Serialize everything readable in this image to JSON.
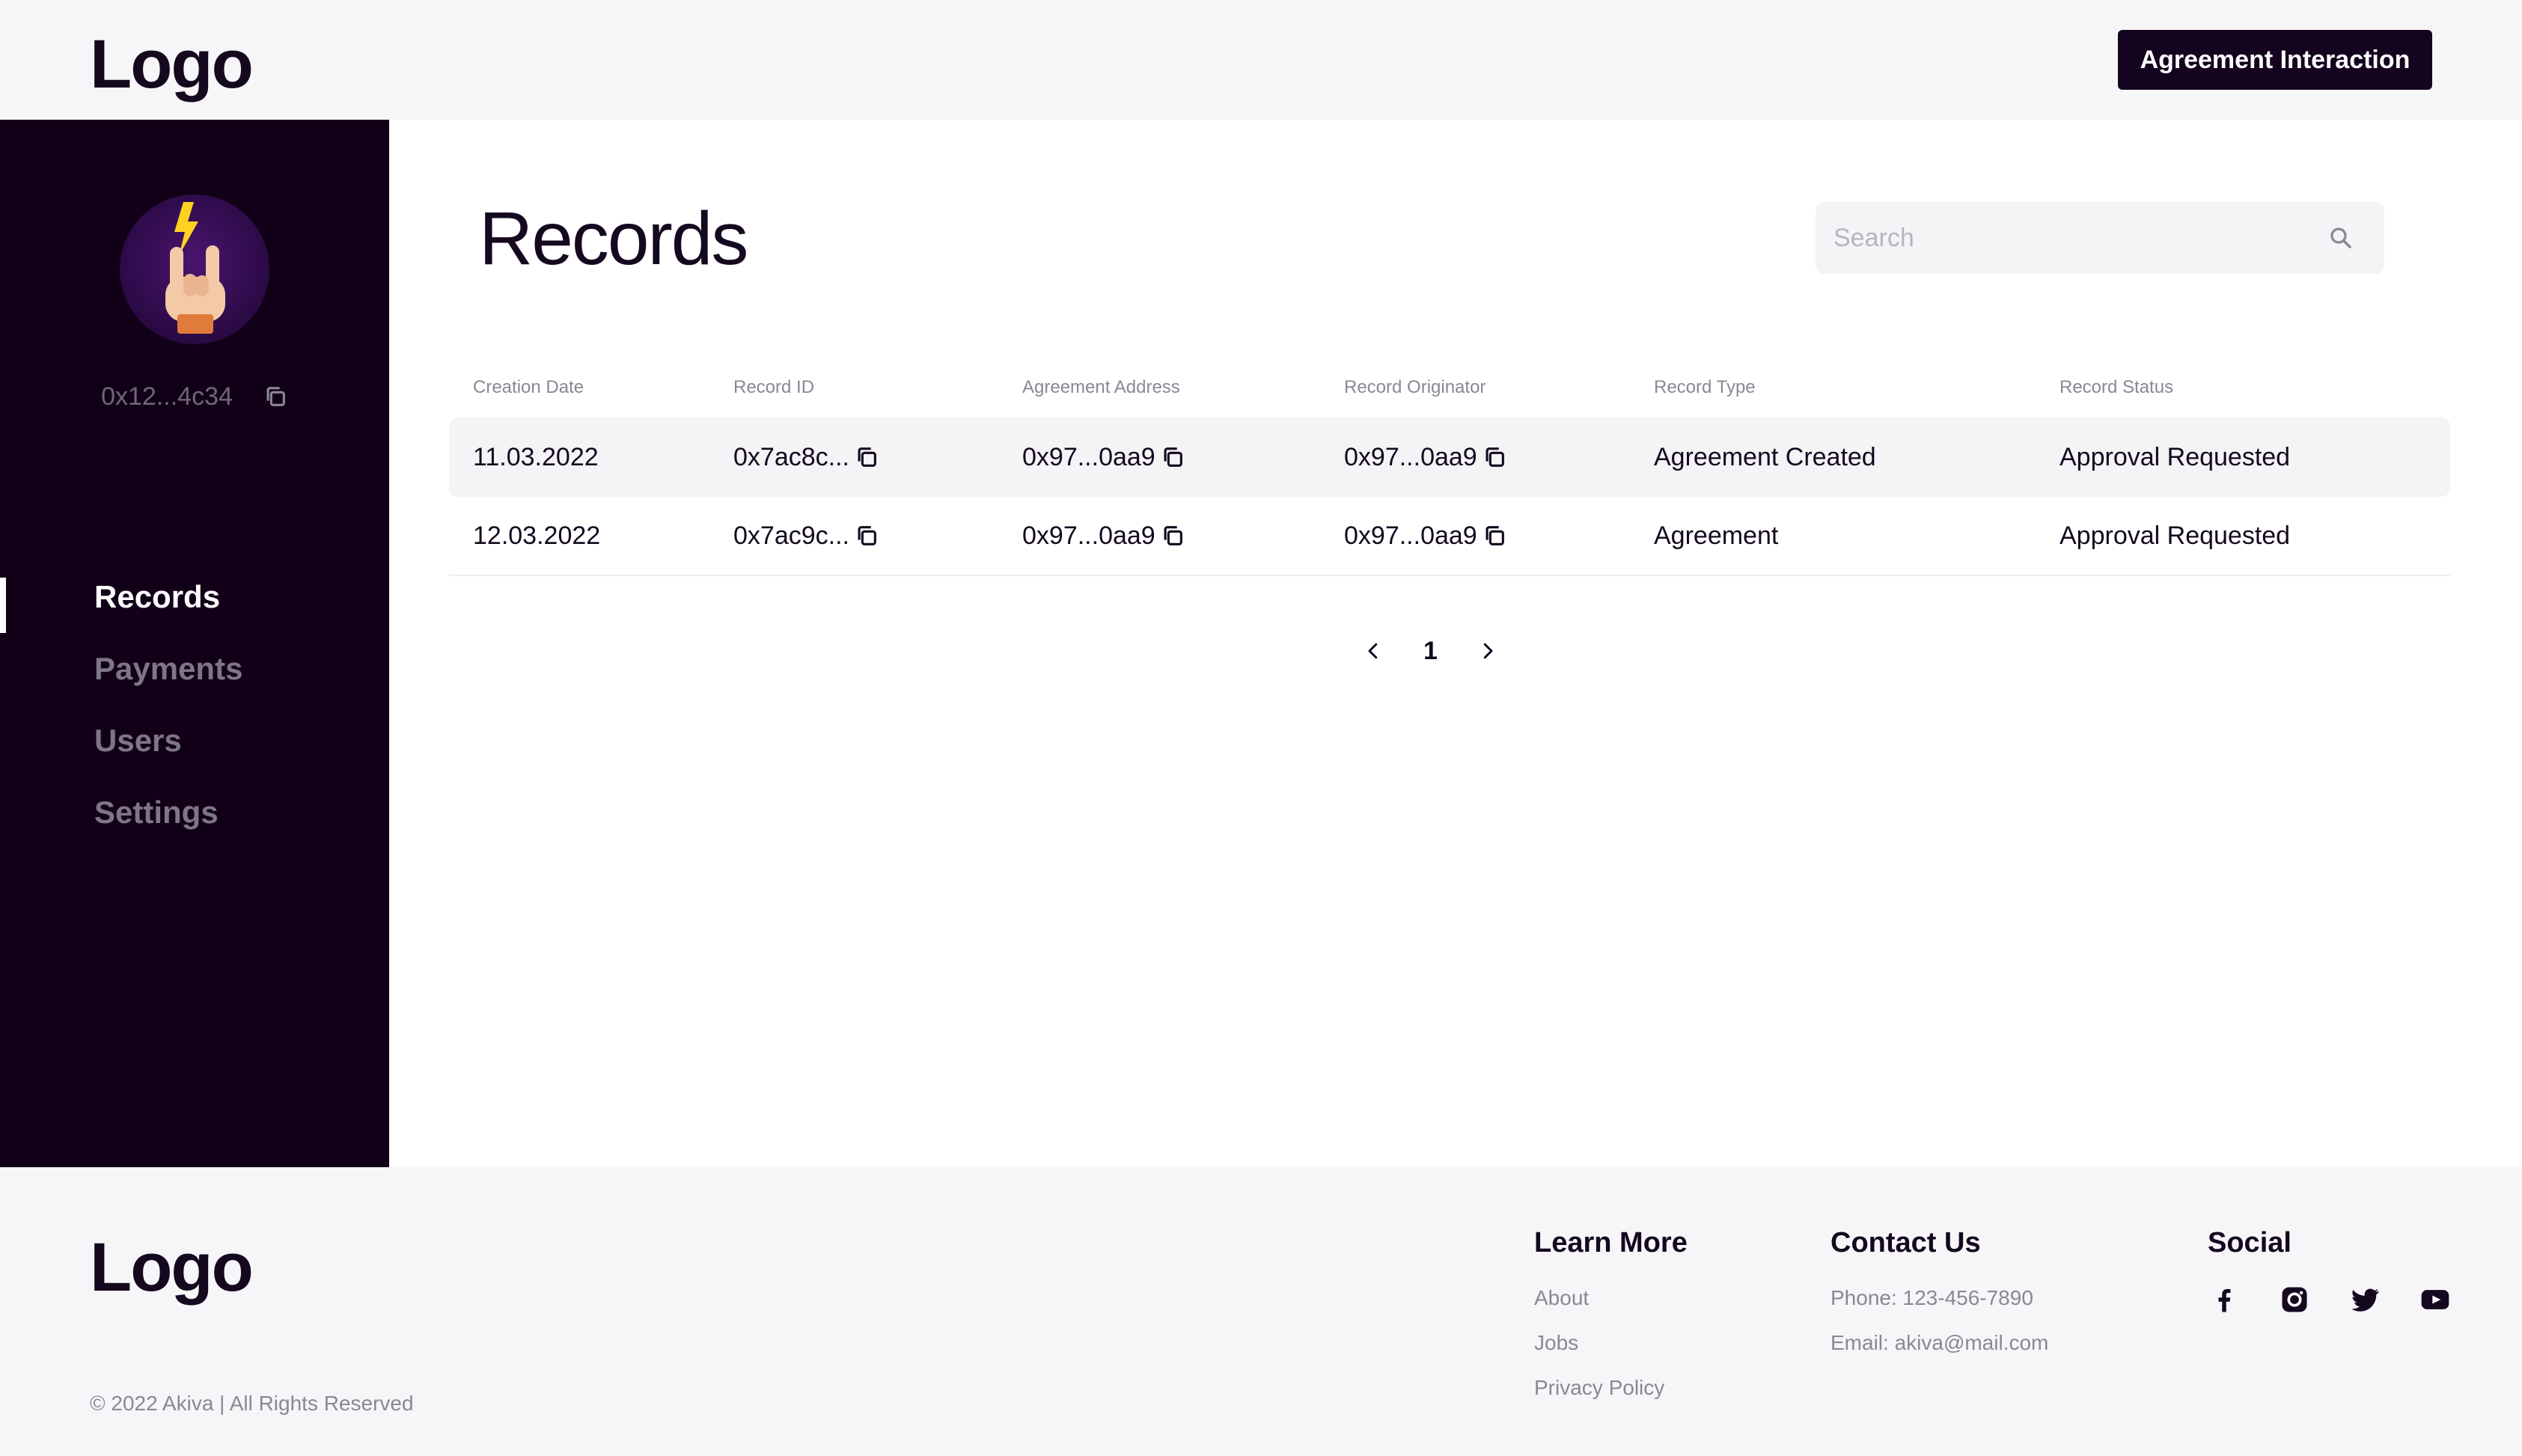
{
  "header": {
    "logo": "Logo",
    "cta_label": "Agreement Interaction"
  },
  "sidebar": {
    "wallet_address": "0x12...4c34",
    "avatar_icon": "rock-hand-lightning-icon",
    "items": [
      {
        "label": "Records",
        "active": true
      },
      {
        "label": "Payments",
        "active": false
      },
      {
        "label": "Users",
        "active": false
      },
      {
        "label": "Settings",
        "active": false
      }
    ]
  },
  "main": {
    "title": "Records",
    "search": {
      "placeholder": "Search",
      "value": ""
    },
    "table": {
      "columns": [
        "Creation Date",
        "Record ID",
        "Agreement Address",
        "Record Originator",
        "Record Type",
        "Record Status"
      ],
      "rows": [
        {
          "creation_date": "11.03.2022",
          "record_id": "0x7ac8c...",
          "agreement_address": "0x97...0aa9",
          "record_originator": "0x97...0aa9",
          "record_type": "Agreement Created",
          "record_status": "Approval Requested"
        },
        {
          "creation_date": "12.03.2022",
          "record_id": "0x7ac9c...",
          "agreement_address": "0x97...0aa9",
          "record_originator": "0x97...0aa9",
          "record_type": "Agreement",
          "record_status": "Approval Requested"
        }
      ]
    },
    "pagination": {
      "current_page": "1"
    }
  },
  "footer": {
    "logo": "Logo",
    "copyright": "© 2022 Akiva | All Rights Reserved",
    "learn_more": {
      "heading": "Learn More",
      "links": [
        "About",
        "Jobs",
        "Privacy Policy"
      ]
    },
    "contact": {
      "heading": "Contact Us",
      "phone": "Phone: 123-456-7890",
      "email": "Email: akiva@mail.com"
    },
    "social": {
      "heading": "Social",
      "icons": [
        "facebook-icon",
        "instagram-icon",
        "twitter-icon",
        "youtube-icon"
      ]
    }
  },
  "colors": {
    "brand_dark": "#14041f",
    "sidebar_bg": "#120018",
    "page_bg": "#f6f5f8",
    "muted_text": "#8c8695"
  }
}
